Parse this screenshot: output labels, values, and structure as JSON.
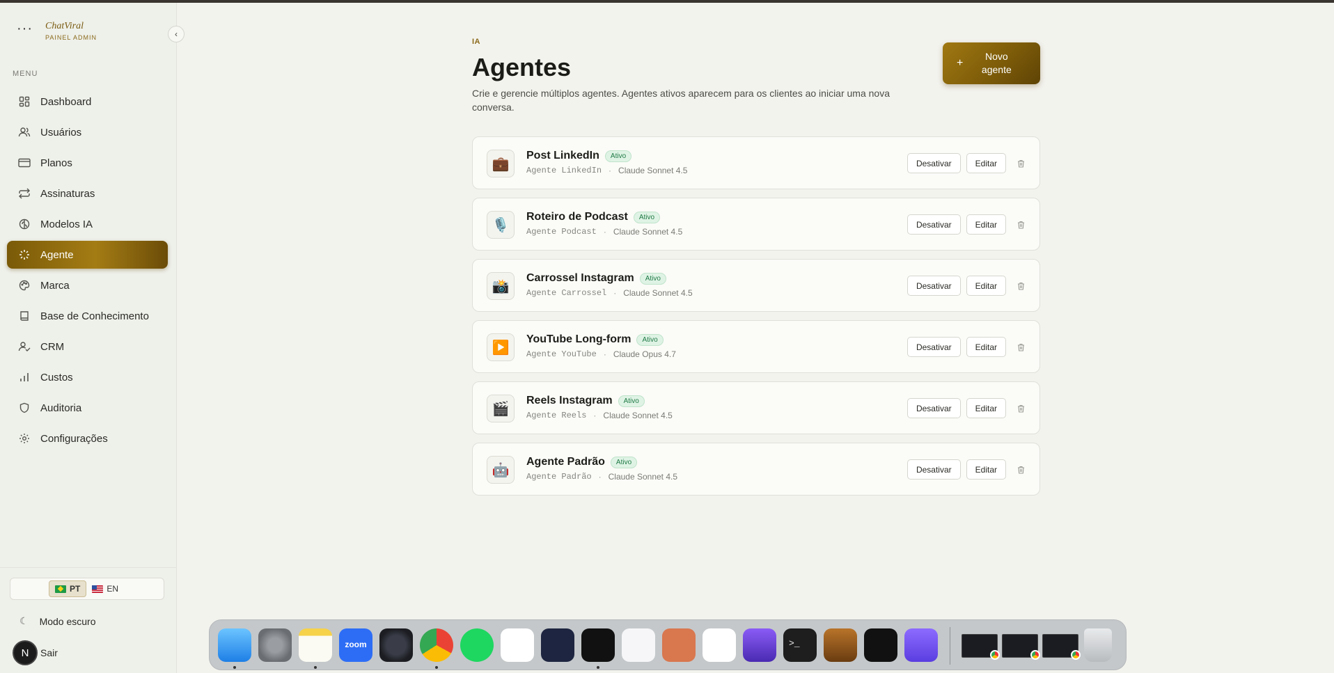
{
  "brand": {
    "name": "ChatViral",
    "subtitle": "PAINEL ADMIN",
    "dots": "···"
  },
  "sidebar": {
    "menu_label": "MENU",
    "items": [
      {
        "label": "Dashboard",
        "icon": "dashboard-icon"
      },
      {
        "label": "Usuários",
        "icon": "users-icon"
      },
      {
        "label": "Planos",
        "icon": "credit-card-icon"
      },
      {
        "label": "Assinaturas",
        "icon": "repeat-icon"
      },
      {
        "label": "Modelos IA",
        "icon": "brain-icon"
      },
      {
        "label": "Agente",
        "icon": "sparkle-icon",
        "active": true
      },
      {
        "label": "Marca",
        "icon": "palette-icon"
      },
      {
        "label": "Base de Conhecimento",
        "icon": "book-icon"
      },
      {
        "label": "CRM",
        "icon": "user-check-icon"
      },
      {
        "label": "Custos",
        "icon": "bar-chart-icon"
      },
      {
        "label": "Auditoria",
        "icon": "shield-icon"
      },
      {
        "label": "Configurações",
        "icon": "gear-icon"
      }
    ],
    "languages": [
      {
        "label": "PT",
        "active": true
      },
      {
        "label": "EN",
        "active": false
      }
    ],
    "dark_mode_label": "Modo escuro",
    "logout_label": "Sair",
    "avatar_initial": "N"
  },
  "page": {
    "eyebrow": "IA",
    "title": "Agentes",
    "description": "Crie e gerencie múltiplos agentes. Agentes ativos aparecem para os clientes ao iniciar uma nova conversa.",
    "new_button_label": "Novo agente",
    "new_button_icon": "+"
  },
  "agents": [
    {
      "name": "Post LinkedIn",
      "status": "Ativo",
      "slug": "Agente LinkedIn",
      "model": "Claude Sonnet 4.5",
      "emoji": "💼"
    },
    {
      "name": "Roteiro de Podcast",
      "status": "Ativo",
      "slug": "Agente Podcast",
      "model": "Claude Sonnet 4.5",
      "emoji": "🎙️"
    },
    {
      "name": "Carrossel Instagram",
      "status": "Ativo",
      "slug": "Agente Carrossel",
      "model": "Claude Sonnet 4.5",
      "emoji": "📸"
    },
    {
      "name": "YouTube Long-form",
      "status": "Ativo",
      "slug": "Agente YouTube",
      "model": "Claude Opus 4.7",
      "emoji": "▶️"
    },
    {
      "name": "Reels Instagram",
      "status": "Ativo",
      "slug": "Agente Reels",
      "model": "Claude Sonnet 4.5",
      "emoji": "🎬"
    },
    {
      "name": "Agente Padrão",
      "status": "Ativo",
      "slug": "Agente Padrão",
      "model": "Claude Sonnet 4.5",
      "emoji": "🤖"
    }
  ],
  "agent_actions": {
    "deactivate": "Desativar",
    "edit": "Editar",
    "separator": "·"
  },
  "dock": {
    "apps": [
      "Finder",
      "System Settings",
      "Notes",
      "Zoom",
      "OBS",
      "Chrome",
      "Spotify",
      "Slack",
      "ChatGPT Atlas",
      "Cursor",
      "Affinity",
      "Claude",
      "ChatGPT",
      "Obsidian",
      "Terminal",
      "GarageBand",
      "CapCut",
      "Notion Calendar"
    ],
    "zoom_label": "zoom",
    "terminal_label": ">_",
    "windows": 3
  }
}
